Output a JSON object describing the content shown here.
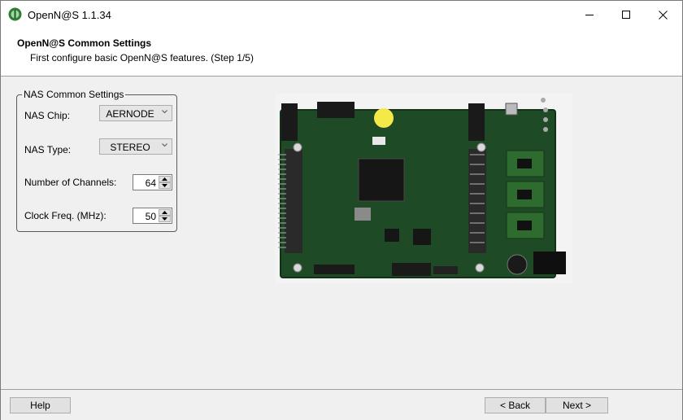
{
  "window": {
    "title": "OpenN@S 1.1.34"
  },
  "header": {
    "title": "OpenN@S Common Settings",
    "subtitle": "First configure basic OpenN@S features. (Step 1/5)"
  },
  "group": {
    "legend": "NAS Common Settings",
    "fields": [
      {
        "label": "NAS Chip:",
        "type": "combo",
        "value": "AERNODE"
      },
      {
        "label": "NAS Type:",
        "type": "combo",
        "value": "STEREO"
      },
      {
        "label": "Number of Channels:",
        "type": "spin",
        "value": "64"
      },
      {
        "label": "Clock Freq. (MHz):",
        "type": "spin",
        "value": "50"
      }
    ]
  },
  "footer": {
    "help": "Help",
    "back": "< Back",
    "next": "Next >"
  },
  "colors": {
    "pcb": "#1f4a26",
    "chip": "#161616",
    "accent": "#3b8c3b"
  },
  "icons": [
    "app-icon",
    "minimize-icon",
    "maximize-icon",
    "close-icon",
    "chevron-down-icon",
    "spin-up-icon",
    "spin-down-icon"
  ]
}
